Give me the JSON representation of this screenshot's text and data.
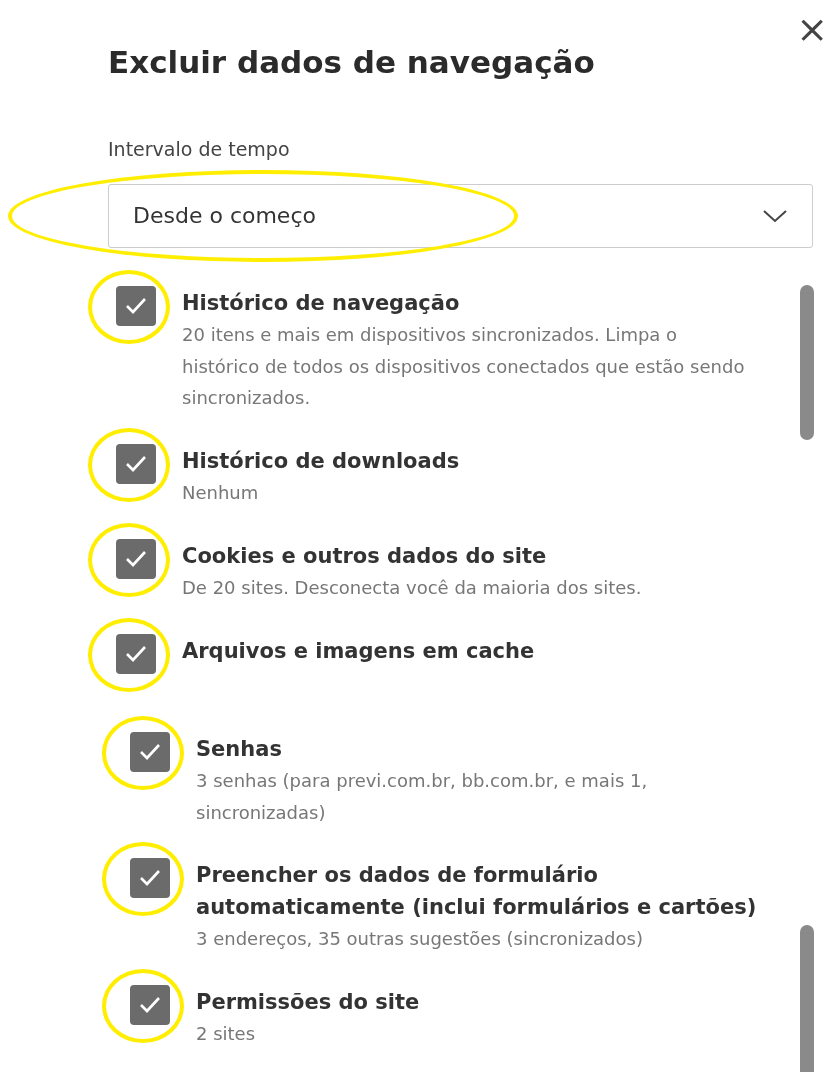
{
  "dialog": {
    "title": "Excluir dados de navegação",
    "close": "×"
  },
  "time_range": {
    "label": "Intervalo de tempo",
    "value": "Desde o começo",
    "highlighted": true
  },
  "items": [
    {
      "title": "Histórico de navegação",
      "description": "20 itens e mais em dispositivos sincronizados. Limpa o histórico de todos os dispositivos conectados que estão sendo sincronizados.",
      "checked": true,
      "highlighted": true
    },
    {
      "title": "Histórico de downloads",
      "description": "Nenhum",
      "checked": true,
      "highlighted": true
    },
    {
      "title": "Cookies e outros dados do site",
      "description": "De 20 sites. Desconecta você da maioria dos sites.",
      "checked": true,
      "highlighted": true
    },
    {
      "title": "Arquivos e imagens em cache",
      "checked": true,
      "highlighted": true
    },
    {
      "title": "Senhas",
      "description": "3 senhas (para previ.com.br, bb.com.br, e mais 1, sincronizadas)",
      "checked": true,
      "highlighted": true
    },
    {
      "title": "Preencher os dados de formulário automaticamente (inclui formulários e cartões)",
      "description": "3 endereços, 35 outras sugestões (sincronizados)",
      "checked": true,
      "highlighted": true
    },
    {
      "title": "Permissões do site",
      "description": "2 sites",
      "checked": true,
      "highlighted": true
    }
  ]
}
